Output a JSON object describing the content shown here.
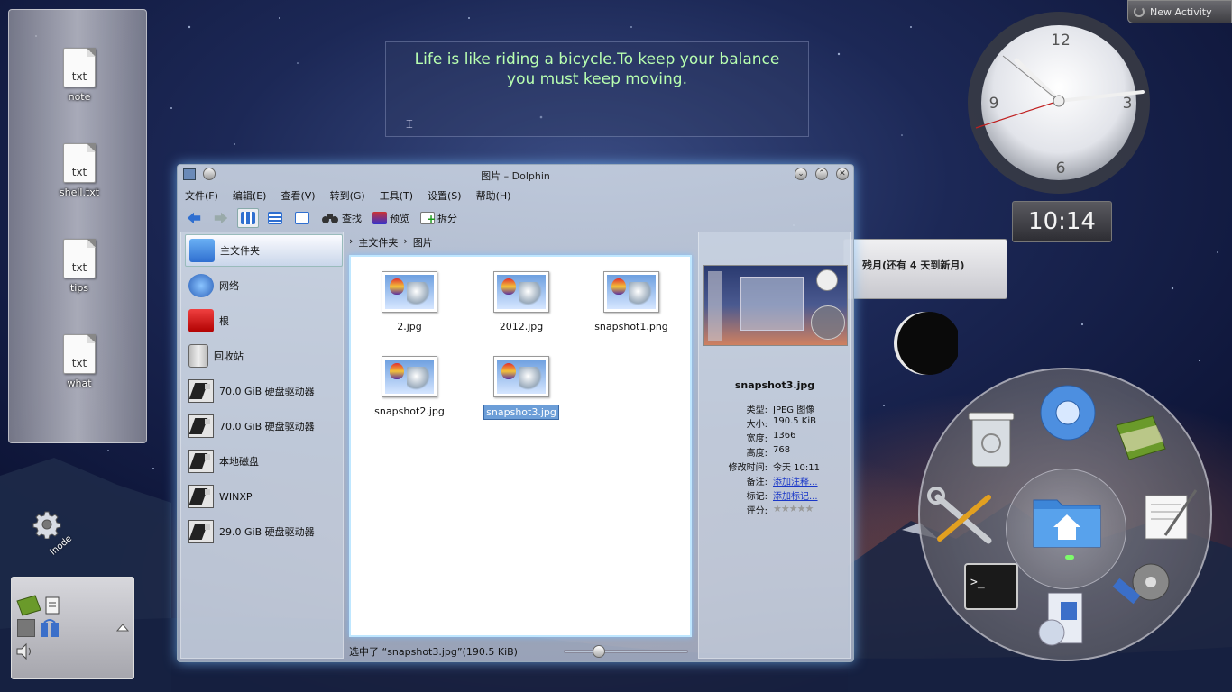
{
  "desktop": {
    "files": [
      {
        "name": "note",
        "icon_text": "txt"
      },
      {
        "name": "shell.txt",
        "icon_text": "txt"
      },
      {
        "name": "tips",
        "icon_text": "txt"
      },
      {
        "name": "what",
        "icon_text": "txt"
      }
    ],
    "gear_label": "inode"
  },
  "quote": {
    "line1": "Life is like riding a bicycle.To keep your balance",
    "line2": "you must keep moving."
  },
  "activity": {
    "label": "New Activity"
  },
  "clock": {
    "numbers": [
      "12",
      "3",
      "6",
      "9"
    ],
    "digital_time": "10:14"
  },
  "moon": {
    "tooltip": "残月(还有 4 天到新月)"
  },
  "dolphin": {
    "title": "图片 – Dolphin",
    "menu": [
      "文件(F)",
      "编辑(E)",
      "查看(V)",
      "转到(G)",
      "工具(T)",
      "设置(S)",
      "帮助(H)"
    ],
    "toolbar": {
      "find": "查找",
      "preview": "预览",
      "split": "拆分"
    },
    "places": [
      {
        "label": "主文件夹",
        "icon": "home-folder-icon"
      },
      {
        "label": "网络",
        "icon": "network-globe-icon"
      },
      {
        "label": "根",
        "icon": "red-folder-icon"
      },
      {
        "label": "回收站",
        "icon": "trash-icon"
      },
      {
        "label": "70.0 GiB 硬盘驱动器",
        "icon": "hard-drive-icon"
      },
      {
        "label": "70.0 GiB 硬盘驱动器",
        "icon": "hard-drive-icon"
      },
      {
        "label": "本地磁盘",
        "icon": "hard-drive-icon"
      },
      {
        "label": "WINXP",
        "icon": "hard-drive-icon"
      },
      {
        "label": "29.0 GiB 硬盘驱动器",
        "icon": "hard-drive-icon"
      }
    ],
    "breadcrumb": [
      "主文件夹",
      "图片"
    ],
    "files": [
      {
        "name": "2.jpg",
        "selected": false
      },
      {
        "name": "2012.jpg",
        "selected": false
      },
      {
        "name": "snapshot1.png",
        "selected": false
      },
      {
        "name": "snapshot2.jpg",
        "selected": false
      },
      {
        "name": "snapshot3.jpg",
        "selected": true
      }
    ],
    "status": "选中了 “snapshot3.jpg”(190.5 KiB)",
    "zoom_fraction": 0.25,
    "info": {
      "name": "snapshot3.jpg",
      "rows": [
        {
          "k": "类型:",
          "v": "JPEG 图像"
        },
        {
          "k": "大小:",
          "v": "190.5 KiB"
        },
        {
          "k": "宽度:",
          "v": "1366"
        },
        {
          "k": "高度:",
          "v": "768"
        },
        {
          "k": "修改时间:",
          "v": "今天 10:11"
        },
        {
          "k": "备注:",
          "v": "添加注释..."
        },
        {
          "k": "标记:",
          "v": "添加标记..."
        },
        {
          "k": "评分:",
          "v": ""
        }
      ],
      "rating": 0
    }
  },
  "colors": {
    "quote_text": "#b8ffb0",
    "selection": "#6c9ed8",
    "window_glow": "#78beff",
    "link": "#1a37c8"
  }
}
